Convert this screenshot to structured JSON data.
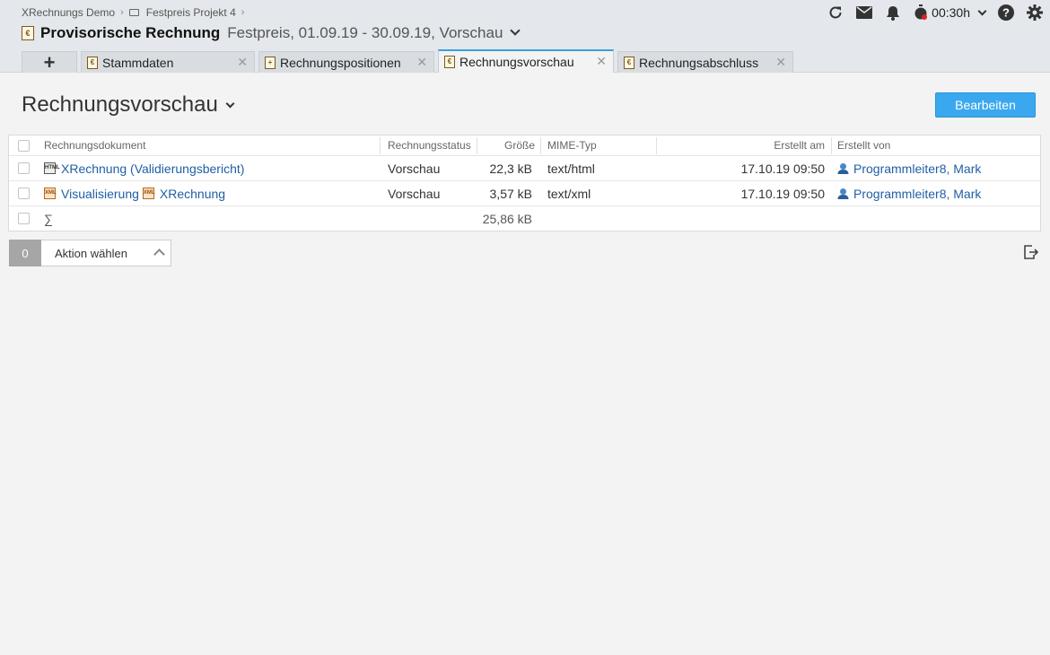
{
  "breadcrumb": [
    "XRechnungs Demo",
    "Festpreis Projekt 4"
  ],
  "title": {
    "main": "Provisorische Rechnung",
    "sub": "Festpreis, 01.09.19 - 30.09.19, Vorschau"
  },
  "topbar": {
    "timer": "00:30h",
    "icons": [
      "refresh-icon",
      "mail-icon",
      "bell-icon",
      "stopwatch-icon",
      "help-icon",
      "gear-icon"
    ]
  },
  "tabs": [
    {
      "label": "Stammdaten",
      "active": false
    },
    {
      "label": "Rechnungspositionen",
      "active": false
    },
    {
      "label": "Rechnungsvorschau",
      "active": true
    },
    {
      "label": "Rechnungsabschluss",
      "active": false
    }
  ],
  "section": {
    "title": "Rechnungsvorschau",
    "edit_button": "Bearbeiten"
  },
  "table": {
    "headers": {
      "document": "Rechnungsdokument",
      "status": "Rechnungsstatus",
      "size": "Größe",
      "mime": "MIME-Typ",
      "created_at": "Erstellt am",
      "created_by": "Erstellt von"
    },
    "rows": [
      {
        "document": "XRechnung (Validierungsbericht)",
        "status": "Vorschau",
        "size": "22,3 kB",
        "mime": "text/html",
        "created_at": "17.10.19 09:50",
        "created_by": "Programmleiter8, Mark"
      },
      {
        "document": "Visualisierung",
        "document2": "XRechnung",
        "status": "Vorschau",
        "size": "3,57 kB",
        "mime": "text/xml",
        "created_at": "17.10.19 09:50",
        "created_by": "Programmleiter8, Mark"
      }
    ],
    "sum": {
      "symbol": "∑",
      "size": "25,86 kB"
    }
  },
  "actions": {
    "count": "0",
    "label": "Aktion wählen"
  },
  "colors": {
    "accent": "#3aa8ee",
    "link": "#1f5fa6"
  }
}
